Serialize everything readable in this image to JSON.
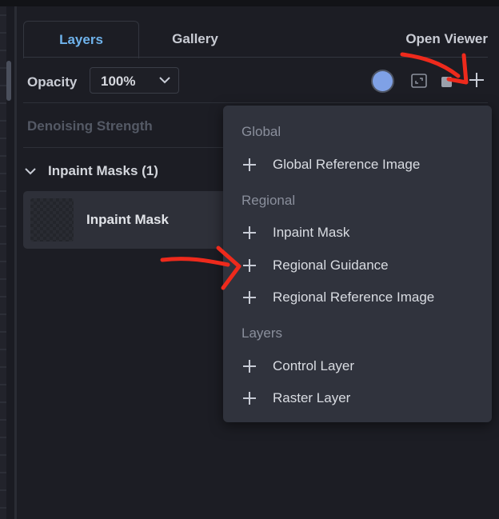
{
  "tabs": {
    "layers": "Layers",
    "gallery": "Gallery",
    "open_viewer": "Open Viewer"
  },
  "toolbar": {
    "opacity_label": "Opacity",
    "opacity_value": "100%",
    "color_swatch": "#7fa1e6"
  },
  "settings": {
    "denoising_label": "Denoising Strength"
  },
  "group": {
    "title": "Inpaint Masks (1)",
    "layers": [
      {
        "name": "Inpaint Mask"
      }
    ]
  },
  "add_menu": {
    "sections": [
      {
        "heading": "Global",
        "items": [
          "Global Reference Image"
        ]
      },
      {
        "heading": "Regional",
        "items": [
          "Inpaint Mask",
          "Regional Guidance",
          "Regional Reference Image"
        ]
      },
      {
        "heading": "Layers",
        "items": [
          "Control Layer",
          "Raster Layer"
        ]
      }
    ]
  },
  "annotations": {
    "arrow_color": "#ee2a1c"
  }
}
